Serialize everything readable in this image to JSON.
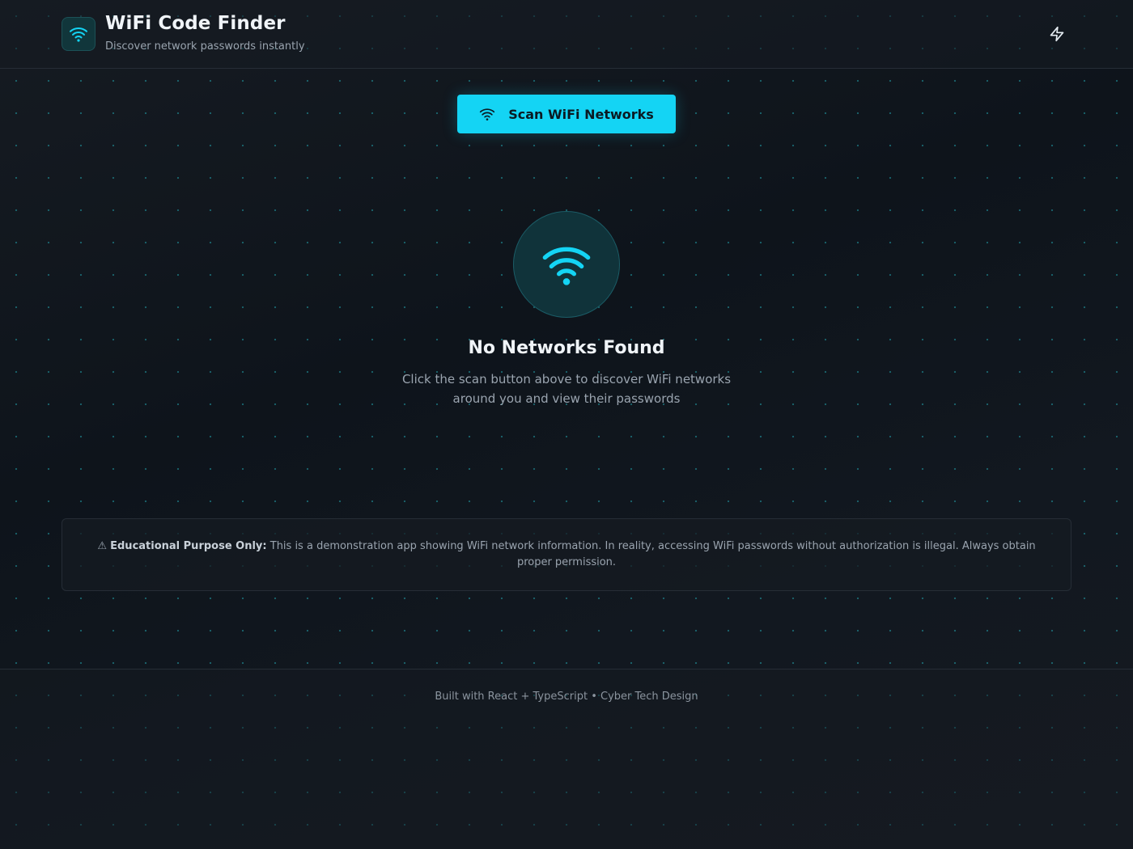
{
  "header": {
    "title": "WiFi Code Finder",
    "subtitle": "Discover network passwords instantly",
    "logo_icon": "wifi-icon",
    "action_icon": "lightning-bolt-icon"
  },
  "scan": {
    "button_label": "Scan WiFi Networks",
    "icon": "wifi-icon"
  },
  "empty_state": {
    "icon": "wifi-icon",
    "title": "No Networks Found",
    "description": "Click the scan button above to discover WiFi networks around you and view their passwords"
  },
  "disclaimer": {
    "icon": "warning-icon",
    "heading": "Educational Purpose Only:",
    "body": "This is a demonstration app showing WiFi network information. In reality, accessing WiFi passwords without authorization is illegal. Always obtain proper permission."
  },
  "footer": {
    "text": "Built with React + TypeScript • Cyber Tech Design"
  },
  "colors": {
    "accent": "#14d4f4",
    "background": "#12171e",
    "surface": "#161b22",
    "border": "#262d36",
    "text_primary": "#f0f4f8",
    "text_secondary": "#9aa4af"
  }
}
